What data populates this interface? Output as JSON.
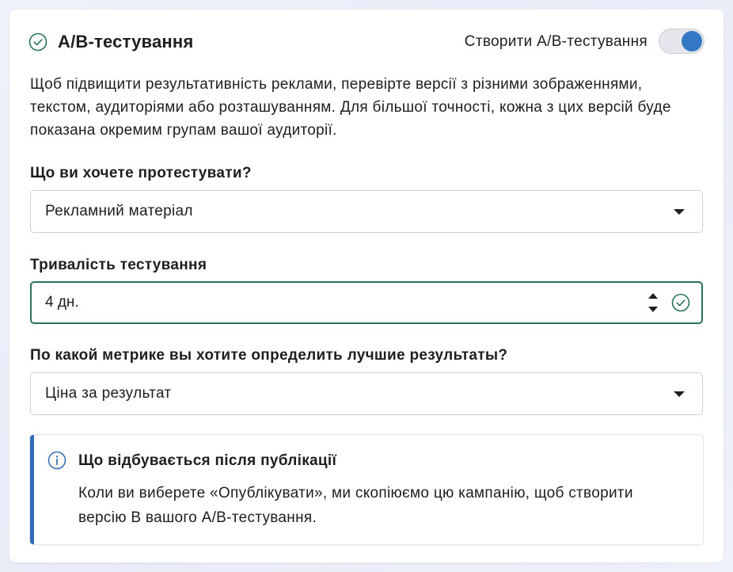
{
  "header": {
    "title": "A/B-тестування",
    "toggle_label": "Створити A/B-тестування",
    "toggle_on": true
  },
  "description": "Щоб підвищити результативність реклами, перевірте версії з різними зображеннями, текстом, аудиторіями або розташуванням. Для більшої точності, кожна з цих версій буде показана окремим групам вашої аудиторії.",
  "test_subject": {
    "label": "Що ви хочете протестувати?",
    "value": "Рекламний матеріал"
  },
  "duration": {
    "label": "Тривалість тестування",
    "value": "4 дн."
  },
  "metric": {
    "label": "По какой метрике вы хотите определить лучшие результаты?",
    "value": "Ціна за результат"
  },
  "info": {
    "title": "Що відбувається після публікації",
    "text": "Коли ви виберете «Опублікувати», ми скопіюємо цю кампанію, щоб створити версію B вашого A/B-тестування."
  },
  "colors": {
    "accent": "#3578c4",
    "success": "#2a7357",
    "info_bar": "#2f6cb5"
  },
  "icons": {
    "title": "check-circle-icon",
    "duration_status": "check-circle-icon",
    "info": "info-icon",
    "select": "caret-down-icon"
  }
}
